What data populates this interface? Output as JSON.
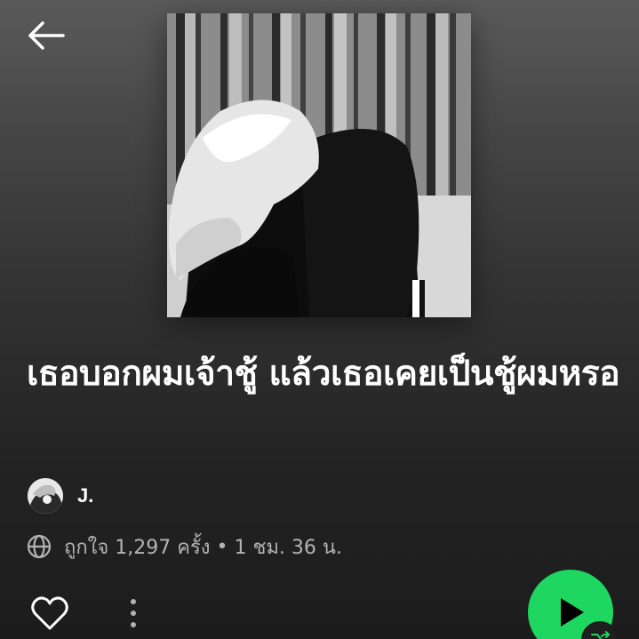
{
  "header": {
    "back_icon": "arrow-left-icon"
  },
  "playlist": {
    "title": "เธอบอกผมเจ้าชู้ แล้วเธอเคยเป็นชู้ผมหรอ",
    "owner": {
      "name": "J.",
      "avatar_icon": "user-avatar"
    },
    "meta": {
      "visibility_icon": "globe-icon",
      "likes": "ถูกใจ 1,297 ครั้ง",
      "separator": "•",
      "duration": "1 ชม. 36 น."
    }
  },
  "actions": {
    "like_icon": "heart-outline-icon",
    "more_icon": "more-vertical-icon",
    "play_icon": "play-icon",
    "shuffle_icon": "shuffle-icon"
  },
  "colors": {
    "accent": "#1ed760",
    "text_secondary": "#b3b3b3",
    "background": "#1c1c1c"
  }
}
